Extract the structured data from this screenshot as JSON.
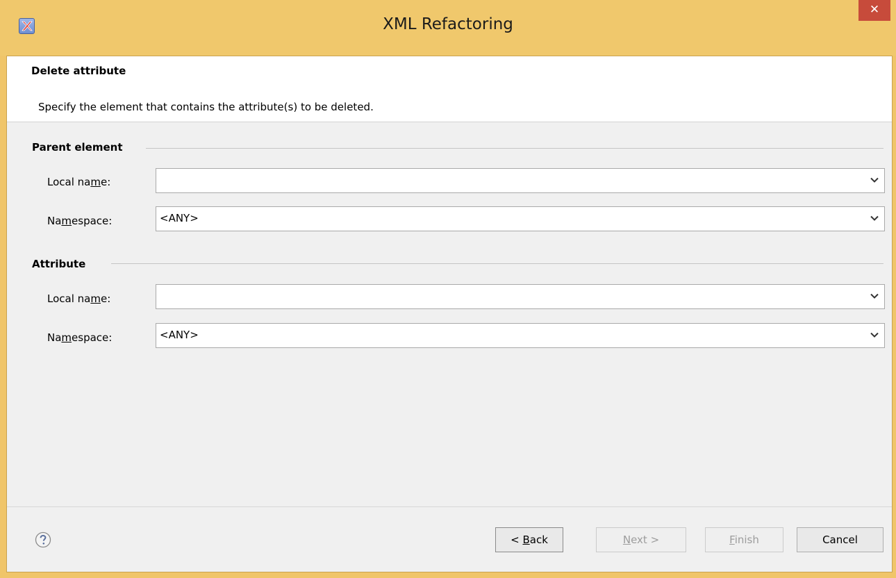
{
  "window": {
    "title": "XML Refactoring",
    "close_glyph": "✕",
    "icon": "xml-refactoring-app-icon"
  },
  "header": {
    "title": "Delete attribute",
    "description": "Specify the element that contains the attribute(s) to be deleted."
  },
  "parent_element": {
    "group_label": "Parent element",
    "local_name_label": "Local name:",
    "local_name_value": "",
    "namespace_label": "Namespace:",
    "namespace_value": "<ANY>"
  },
  "attribute": {
    "group_label": "Attribute",
    "local_name_label": "Local name:",
    "local_name_value": "",
    "namespace_label": "Namespace:",
    "namespace_value": "<ANY>"
  },
  "footer": {
    "help_icon": "question-mark-icon",
    "back_label": "< Back",
    "next_label": "Next >",
    "finish_label": "Finish",
    "cancel_label": "Cancel"
  },
  "colors": {
    "title_bar": "#f0c86c",
    "close_button": "#c74b3b",
    "dialog_background": "#f0f0f0",
    "header_background": "#ffffff"
  }
}
